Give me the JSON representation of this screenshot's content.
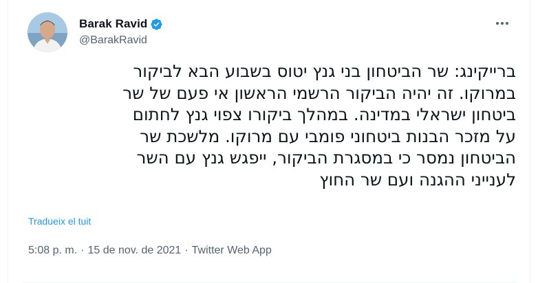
{
  "author": {
    "display_name": "Barak Ravid",
    "handle": "@BarakRavid",
    "verified": true,
    "verified_color": "#1d9bf0"
  },
  "tweet": {
    "lines": [
      "ברייקינג: שר הביטחון בני גנץ יטוס בשבוע הבא לביקור",
      "במרוקו. זה יהיה הביקור הרשמי הראשון אי פעם של שר",
      "ביטחון ישראלי במדינה. במהלך ביקורו צפוי גנץ לחתום",
      "על מזכר הבנות ביטחוני פומבי עם מרוקו. מלשכת שר",
      "הביטחון נמסר כי במסגרת הביקור, ייפגש גנץ עם השר",
      "לענייני ההגנה ועם שר החוץ"
    ],
    "translate_label": "Tradueix el tuit"
  },
  "meta": {
    "time": "5:08 p. m.",
    "separator": "·",
    "date": "15 de nov. de 2021",
    "app": "Twitter Web App"
  },
  "colors": {
    "text": "#0f1419",
    "secondary": "#536471",
    "link": "#1d9bf0"
  }
}
